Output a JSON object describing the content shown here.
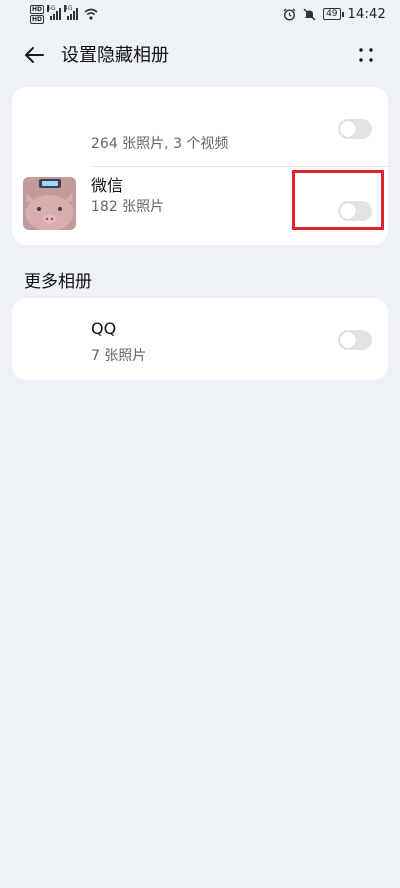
{
  "status_bar": {
    "network_tags": [
      "HD",
      "HD"
    ],
    "signal1_tag": "5G",
    "signal2_tag": "4G",
    "battery": "49",
    "time": "14:42"
  },
  "header": {
    "title": "设置隐藏相册"
  },
  "albums": [
    {
      "name": "",
      "count": "264 张照片, 3 个视频",
      "enabled": false
    },
    {
      "name": "微信",
      "count": "182 张照片",
      "enabled": false
    }
  ],
  "more_section": {
    "title": "更多相册",
    "albums": [
      {
        "name": "QQ",
        "count": "7 张照片",
        "enabled": false
      }
    ]
  },
  "icons": {
    "back": "back-arrow-icon",
    "more": "more-options-icon",
    "alarm": "alarm-icon",
    "mute": "mute-icon",
    "wifi": "wifi-icon"
  },
  "colors": {
    "background": "#eef1f5",
    "card": "#ffffff",
    "toggle_off": "#e3e3e3",
    "highlight": "#e0222e"
  }
}
